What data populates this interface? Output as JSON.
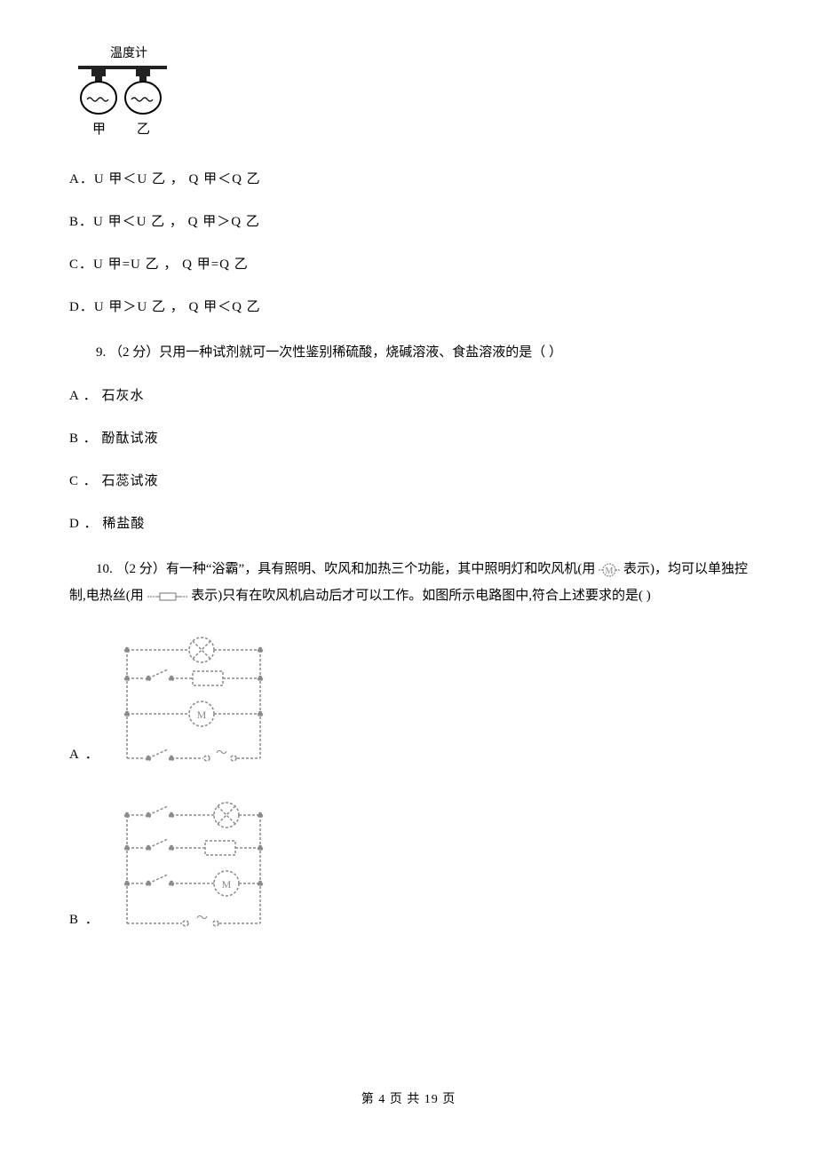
{
  "figure_top": {
    "label_top": "温度计",
    "label_bottom": "甲     乙"
  },
  "q8_options": {
    "A": "A．U 甲＜U 乙 ，  Q 甲＜Q 乙",
    "B": "B．U 甲＜U 乙 ，  Q 甲＞Q 乙",
    "C": "C．U 甲=U 乙 ，  Q 甲=Q 乙",
    "D": "D．U 甲＞U 乙 ，  Q 甲＜Q 乙"
  },
  "q9": {
    "stem": "9. （2 分）只用一种试剂就可一次性鉴别稀硫酸，烧碱溶液、食盐溶液的是（    ）",
    "options": {
      "A": "A ． 石灰水",
      "B": "B ． 酚酞试液",
      "C": "C ． 石蕊试液",
      "D": "D ． 稀盐酸"
    }
  },
  "q10": {
    "stem_1": "10. （2 分）有一种“浴霸”，具有照明、吹风和加热三个功能，其中照明灯和吹风机(用 ",
    "stem_2": " 表示)，均可以单独控制,电热丝(用 ",
    "stem_3": " 表示)只有在吹风机启动后才可以工作。如图所示电路图中,符合上述要求的是(     )",
    "options": {
      "A": "A ．",
      "B": "B ．"
    }
  },
  "footer": "第 4 页 共 19 页"
}
